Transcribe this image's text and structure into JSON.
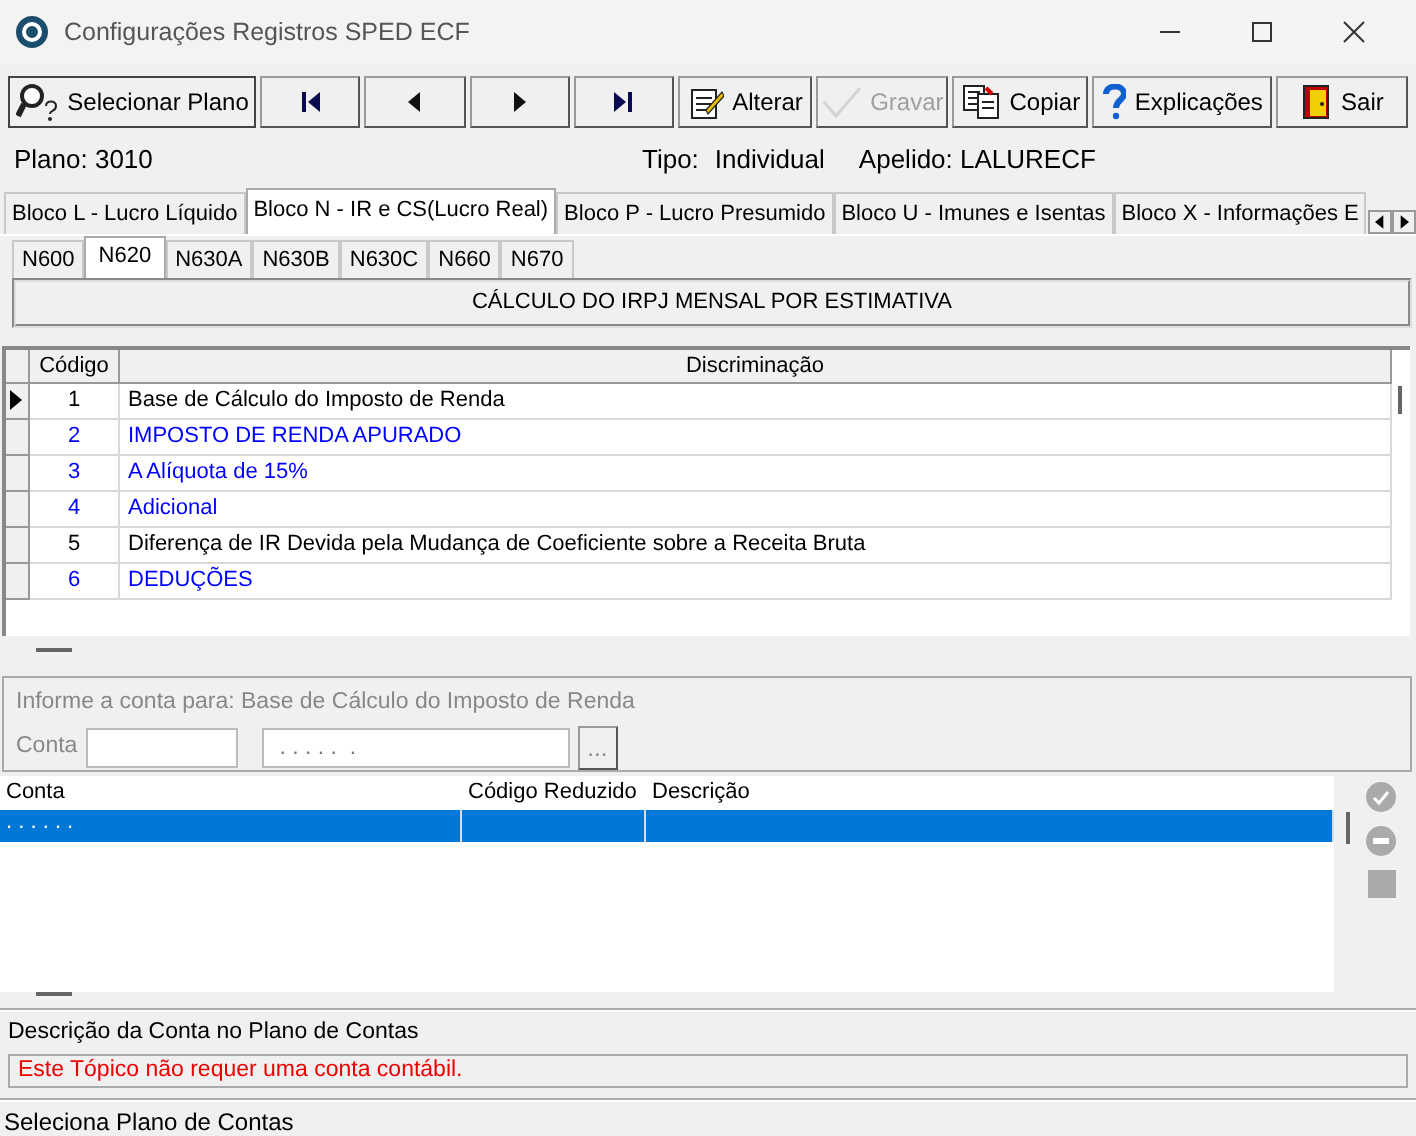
{
  "window": {
    "title": "Configurações Registros SPED ECF"
  },
  "toolbar": [
    {
      "kind": "select",
      "label": "Selecionar Plano",
      "disabled": false
    },
    {
      "kind": "first",
      "disabled": false
    },
    {
      "kind": "prev",
      "disabled": false
    },
    {
      "kind": "next",
      "disabled": false
    },
    {
      "kind": "last",
      "disabled": false
    },
    {
      "kind": "edit",
      "label": "Alterar",
      "disabled": false
    },
    {
      "kind": "save",
      "label": "Gravar",
      "disabled": true
    },
    {
      "kind": "copy",
      "label": "Copiar",
      "disabled": false
    },
    {
      "kind": "help",
      "label": "Explicações",
      "disabled": false
    },
    {
      "kind": "exit",
      "label": "Sair",
      "disabled": false
    }
  ],
  "info": {
    "plano": "Plano: 3010",
    "tipo_label": "Tipo:",
    "tipo": "Individual",
    "apelido": "Apelido: LALURECF"
  },
  "block_tabs": [
    {
      "label": "Bloco L - Lucro Líquido",
      "selected": false
    },
    {
      "label": "Bloco N - IR e CS(Lucro Real)",
      "selected": true
    },
    {
      "label": "Bloco P - Lucro Presumido",
      "selected": false
    },
    {
      "label": "Bloco U - Imunes e Isentas",
      "selected": false
    },
    {
      "label": "Bloco X - Informações E",
      "selected": false
    }
  ],
  "register_tabs": [
    {
      "label": "N600",
      "selected": false
    },
    {
      "label": "N620",
      "selected": true
    },
    {
      "label": "N630A",
      "selected": false
    },
    {
      "label": "N630B",
      "selected": false
    },
    {
      "label": "N630C",
      "selected": false
    },
    {
      "label": "N660",
      "selected": false
    },
    {
      "label": "N670",
      "selected": false
    }
  ],
  "section_title": "CÁLCULO DO IRPJ MENSAL POR ESTIMATIVA",
  "table": {
    "columns": [
      "Código",
      "Discriminação"
    ],
    "rows": [
      {
        "code": "1",
        "text": "Base de Cálculo do Imposto de Renda",
        "color": "#000000",
        "selected": true
      },
      {
        "code": "2",
        "text": "IMPOSTO DE RENDA APURADO",
        "color": "#0000ff",
        "selected": false
      },
      {
        "code": "3",
        "text": "A Alíquota de 15%",
        "color": "#0000ff",
        "selected": false
      },
      {
        "code": "4",
        "text": "Adicional",
        "color": "#0000ff",
        "selected": false
      },
      {
        "code": "5",
        "text": "Diferença de IR Devida pela Mudança de Coeficiente sobre a Receita Bruta",
        "color": "#000000",
        "selected": false
      },
      {
        "code": "6",
        "text": "DEDUÇÕES",
        "color": "#0000ff",
        "selected": false
      }
    ]
  },
  "account_panel": {
    "title": "Informe a conta para: Base de Cálculo do Imposto de Renda",
    "conta_label": "Conta",
    "mask": ". . . . .  .",
    "browse": "..."
  },
  "account_table": {
    "columns": [
      "Conta",
      "Código Reduzido",
      "Descrição"
    ],
    "rows": [
      {
        "conta": ". . . . .  .",
        "selected": true
      }
    ]
  },
  "description": {
    "label": "Descrição da Conta no Plano de Contas",
    "message": "Este Tópico não requer uma conta contábil."
  },
  "status_bar": "Seleciona Plano de Contas"
}
